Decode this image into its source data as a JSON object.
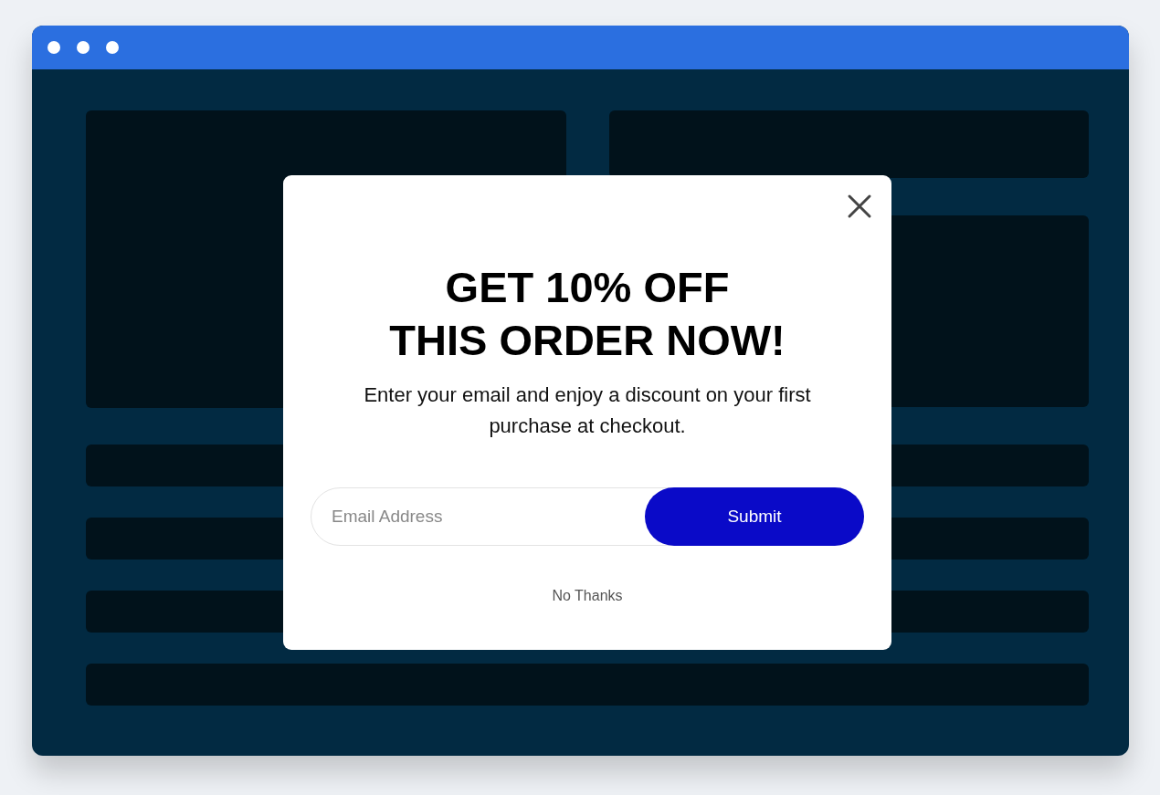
{
  "popup": {
    "heading_lines": [
      "GET 10% OFF",
      "THIS ORDER NOW!"
    ],
    "text": "Enter your email and enjoy a discount on your first purchase at checkout.",
    "email": {
      "placeholder": "Email Address"
    },
    "submit": "Submit",
    "dismiss": "No Thanks"
  }
}
